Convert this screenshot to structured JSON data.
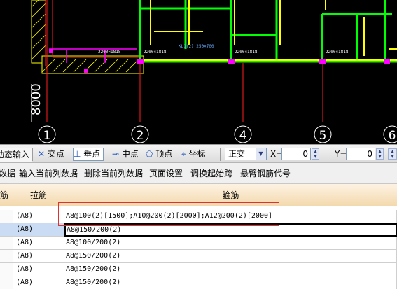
{
  "cad": {
    "axis_labels": [
      "1",
      "2",
      "4",
      "5",
      "6"
    ],
    "dimension_left": "8000",
    "beam_labels": [
      "2200×1818",
      "2200×1818",
      "2200×1818",
      "2200×1818"
    ],
    "colors": {
      "background": "#000000",
      "green": "#00ff00",
      "yellow": "#ffff00",
      "red": "#ff2020",
      "magenta": "#ff00ff",
      "white": "#ffffff"
    }
  },
  "snapbar": {
    "dynamic_input": "动态输入",
    "intersection": "交点",
    "perpendicular": "垂点",
    "midpoint": "中点",
    "vertex": "顶点",
    "coordinate": "坐标",
    "ortho_mode": "正交",
    "x_label": "X=",
    "x_value": "0",
    "y_label": "Y=",
    "y_value": "0"
  },
  "menubar": {
    "items": [
      "数据",
      "输入当前列数据",
      "删除当前列数据",
      "页面设置",
      "调换起始跨",
      "悬臂钢筋代号"
    ]
  },
  "grid": {
    "headers": [
      "筋",
      "拉筋",
      "箍筋"
    ],
    "rows": [
      {
        "tie": "(A8)",
        "stirrup": "A8@100(2)[1500];A10@200(2)[2000];A12@200(2)[2000]"
      },
      {
        "tie": "(A8)",
        "stirrup": "A8@150/200(2)"
      },
      {
        "tie": "(A8)",
        "stirrup": "A8@100/200(2)"
      },
      {
        "tie": "(A8)",
        "stirrup": "A8@150/200(2)"
      },
      {
        "tie": "(A8)",
        "stirrup": "A8@150/200(2)"
      },
      {
        "tie": "(A8)",
        "stirrup": "A8@150/200(2)"
      }
    ],
    "selected_row": 1
  }
}
